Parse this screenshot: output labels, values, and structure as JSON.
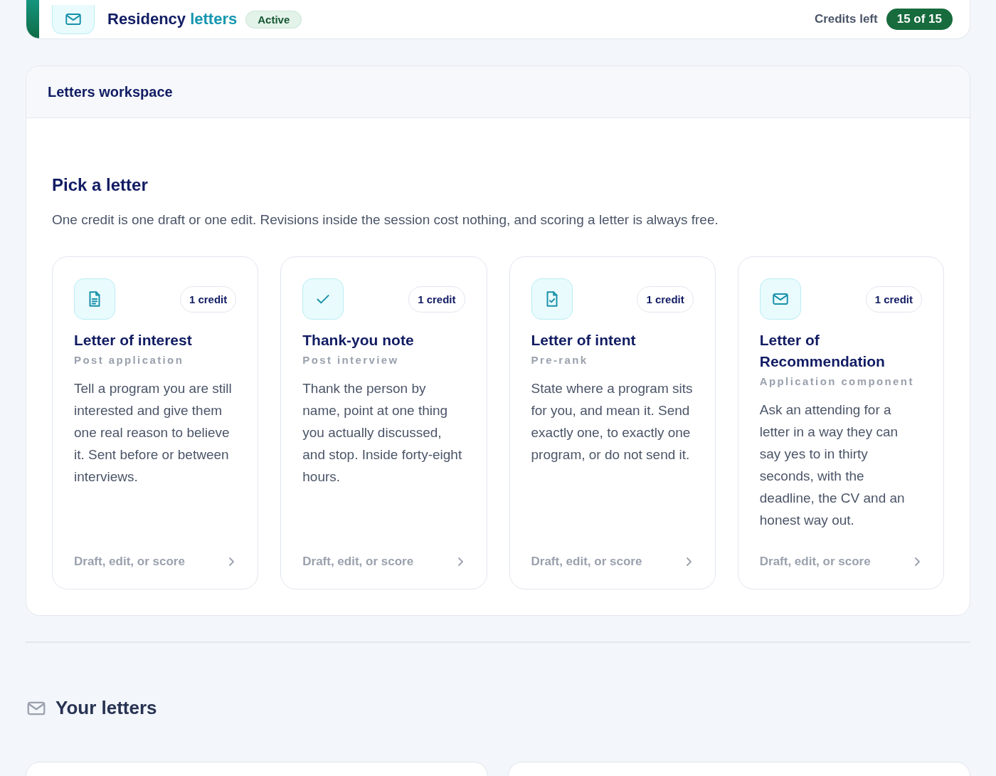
{
  "header": {
    "title": "Residency",
    "title_accent": "letters",
    "status": "Active",
    "credits_label": "Credits left",
    "credits_value": "15 of 15"
  },
  "workspace": {
    "title": "Letters workspace",
    "heading": "Pick a letter",
    "intro": "One credit is one draft or one edit. Revisions inside the session cost nothing, and scoring a letter is always free.",
    "letters": [
      {
        "kind": "document",
        "cost": "1 credit",
        "title": "Letter of interest",
        "stage": "Post application",
        "description": "Tell a program you are still interested and give them one real reason to believe it. Sent before or between interviews.",
        "action": "Draft, edit, or score"
      },
      {
        "kind": "check",
        "cost": "1 credit",
        "title": "Thank-you note",
        "stage": "Post interview",
        "description": "Thank the person by name, point at one thing you actually discussed, and stop. Inside forty-eight hours.",
        "action": "Draft, edit, or score"
      },
      {
        "kind": "document-check",
        "cost": "1 credit",
        "title": "Letter of intent",
        "stage": "Pre-rank",
        "description": "State where a program sits for you, and mean it. Send exactly one, to exactly one program, or do not send it.",
        "action": "Draft, edit, or score"
      },
      {
        "kind": "envelope",
        "cost": "1 credit",
        "title": "Letter of Recommendation",
        "stage": "Application component",
        "description": "Ask an attending for a letter in a way they can say yes to in thirty seconds, with the deadline, the CV and an honest way out.",
        "action": "Draft, edit, or score"
      }
    ]
  },
  "your_letters": {
    "title": "Your letters"
  }
}
